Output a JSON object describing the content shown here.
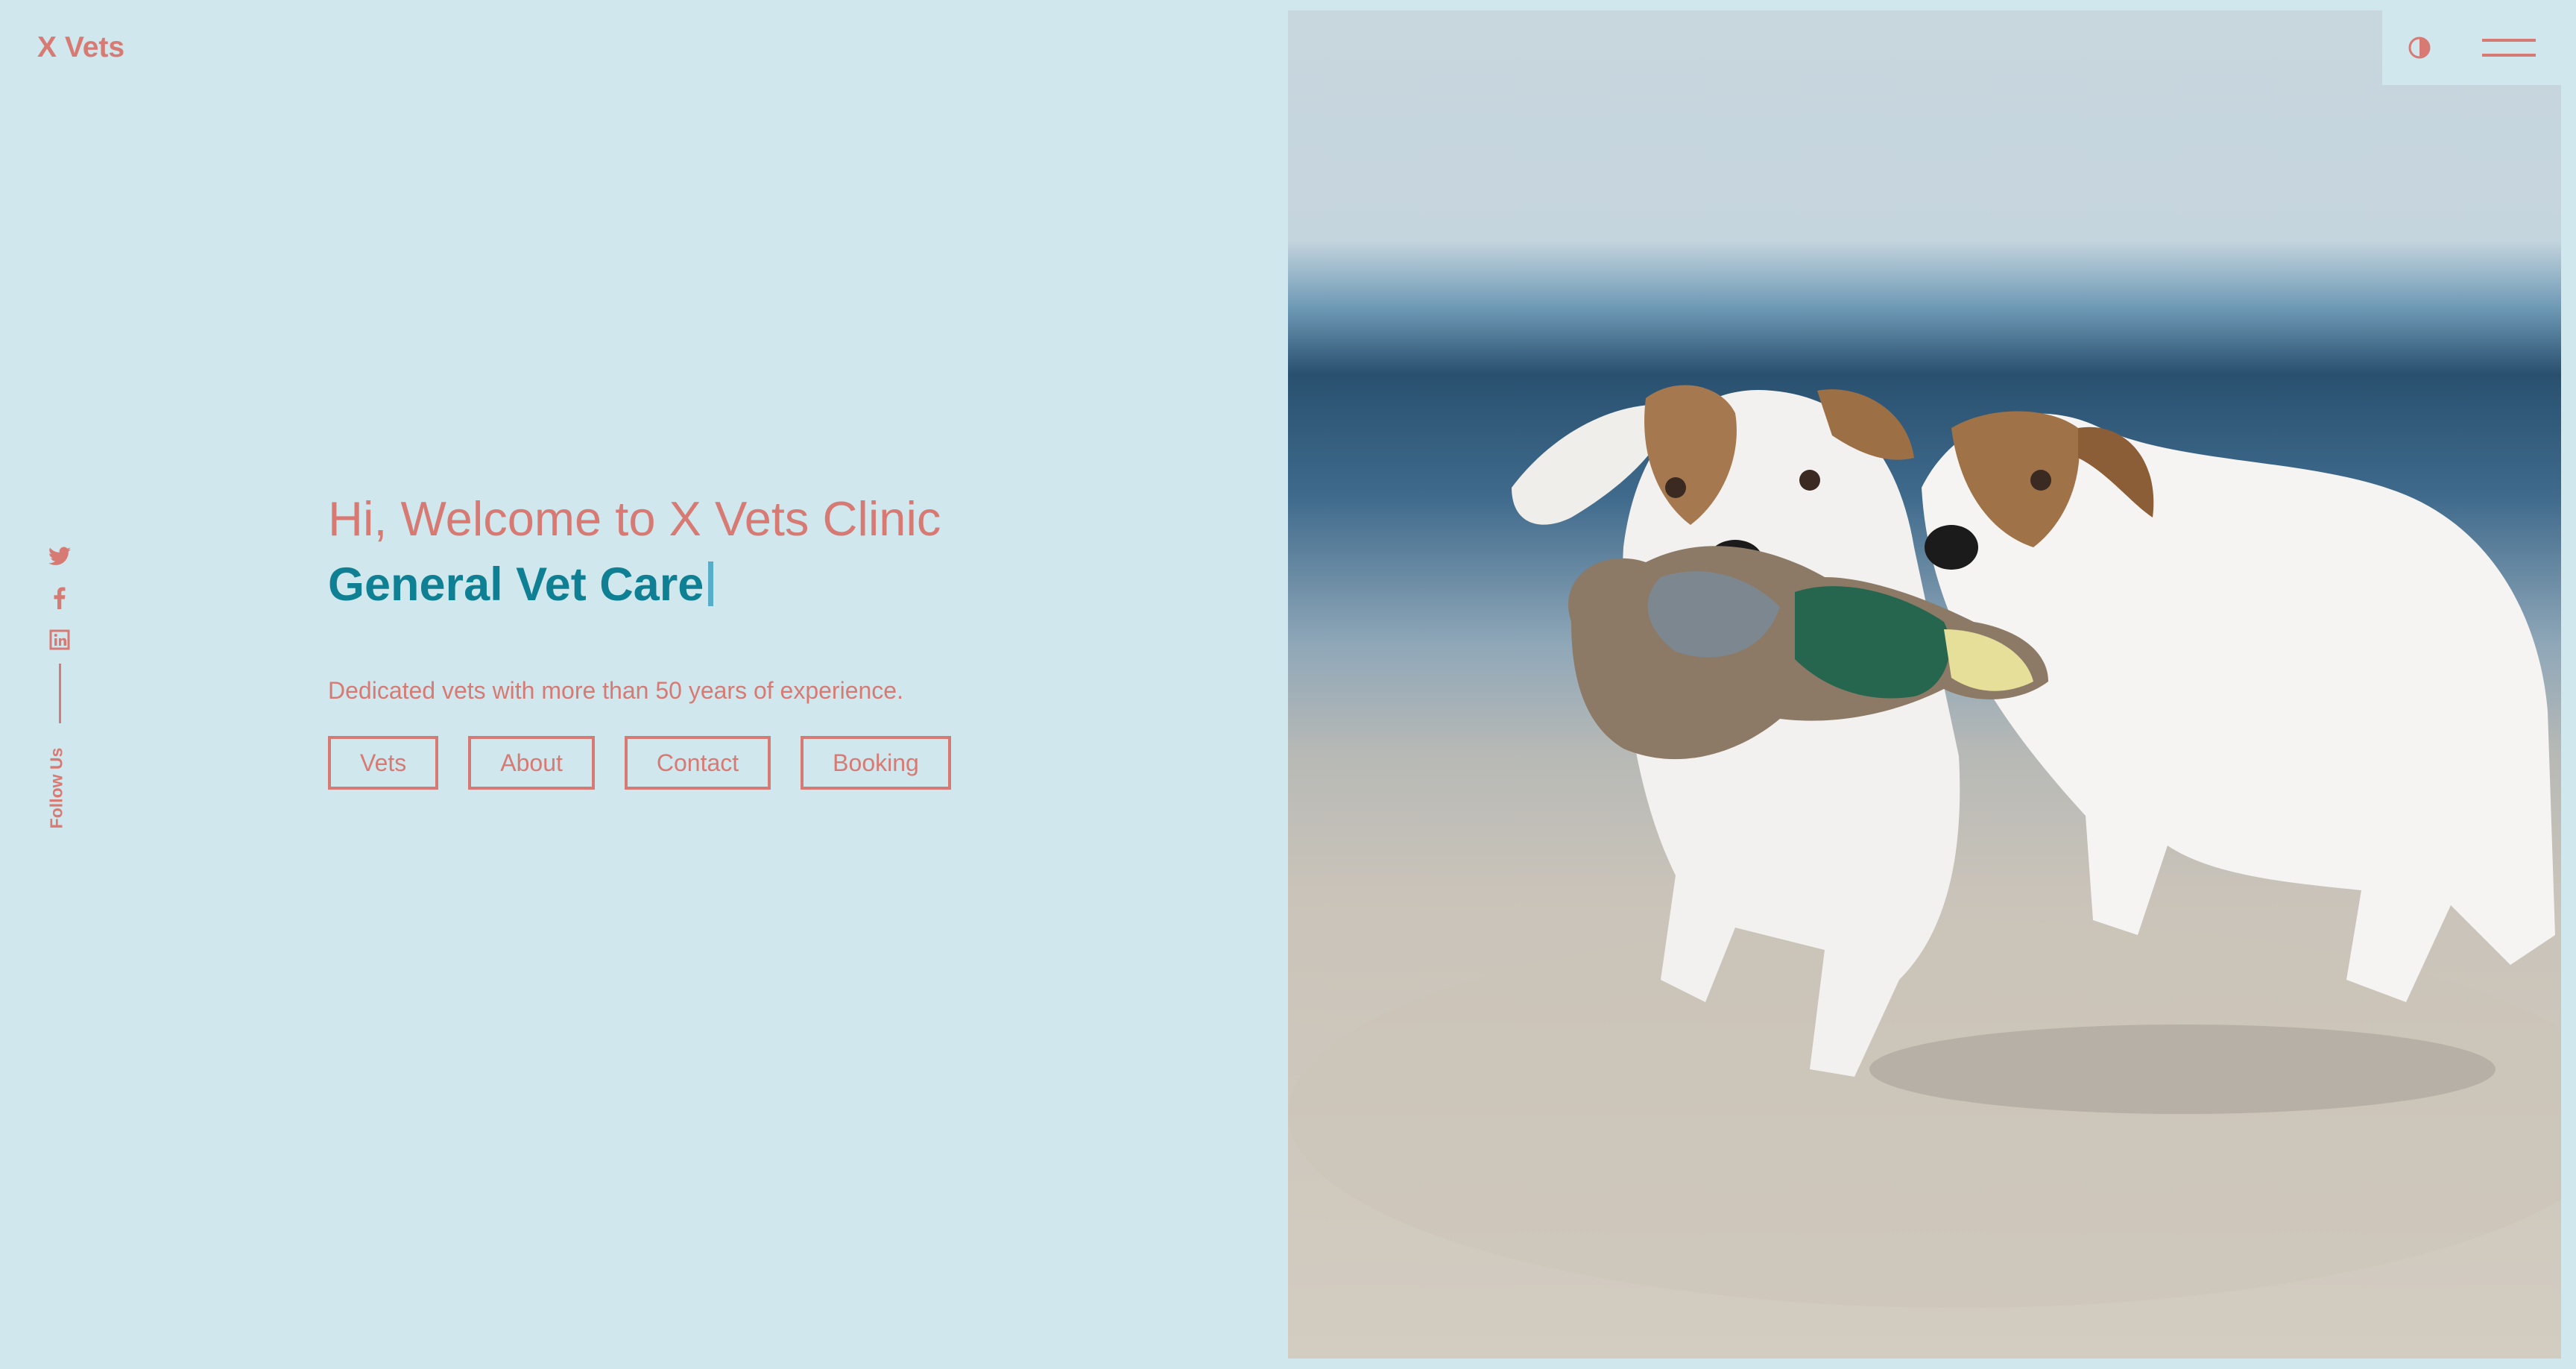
{
  "header": {
    "logo": "X Vets"
  },
  "social": {
    "items": [
      {
        "icon": "twitter-icon"
      },
      {
        "icon": "facebook-icon"
      },
      {
        "icon": "linkedin-icon"
      }
    ],
    "follow_label": "Follow Us"
  },
  "hero": {
    "greeting": "Hi, Welcome to X Vets Clinic",
    "typed_text": "General Vet Care",
    "tagline": "Dedicated vets with more than 50 years of experience.",
    "buttons": [
      {
        "label": "Vets"
      },
      {
        "label": "About"
      },
      {
        "label": "Contact"
      },
      {
        "label": "Booking"
      }
    ]
  },
  "controls": {
    "theme_icon": "contrast-icon",
    "menu_icon": "menu-icon"
  },
  "photo": {
    "subject": "two dogs running on beach with toy"
  },
  "colors": {
    "background": "#cfe7ed",
    "accent": "#d87a74",
    "highlight": "#0f8093"
  }
}
